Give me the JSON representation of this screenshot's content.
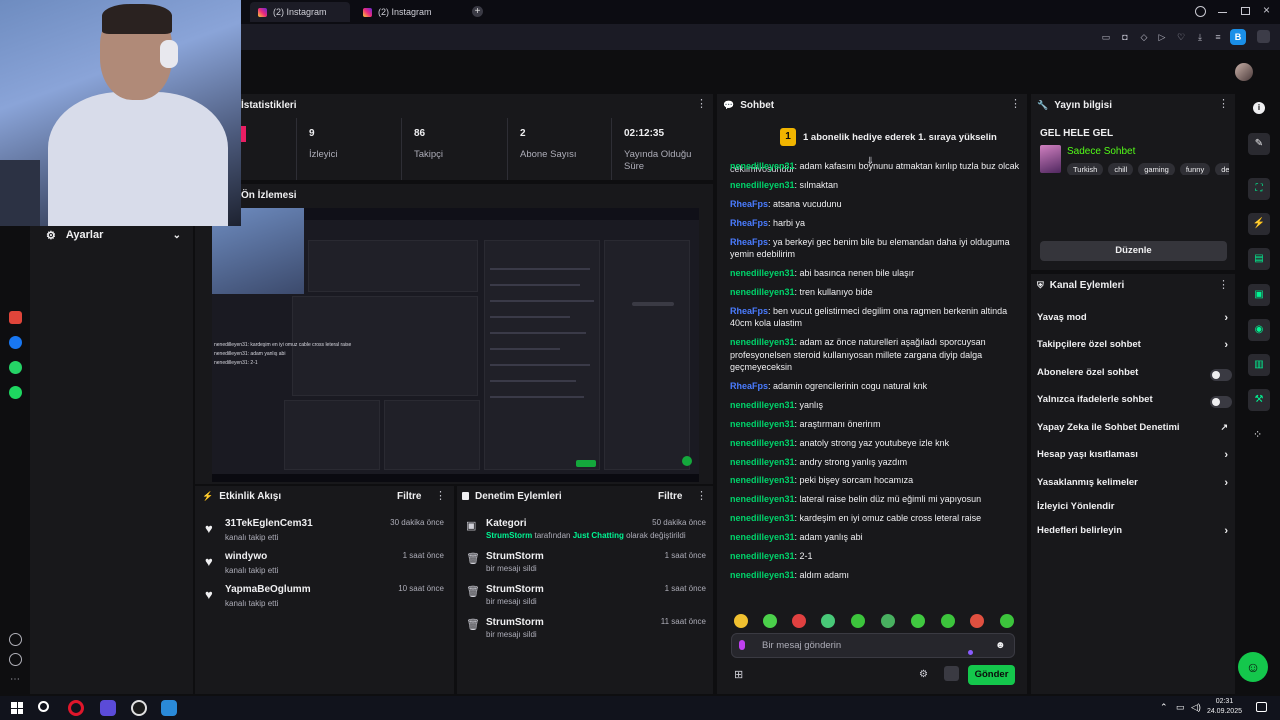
{
  "browser": {
    "tabs": [
      {
        "label": "(2) Instagram"
      },
      {
        "label": "(2) Instagram"
      }
    ],
    "avatar_letter": "B"
  },
  "left_panel": {
    "settings_label": "Ayarlar"
  },
  "stats": {
    "title": "İstatistikleri",
    "items": [
      {
        "value": "9",
        "label": "İzleyici"
      },
      {
        "value": "86",
        "label": "Takipçi"
      },
      {
        "value": "2",
        "label": "Abone Sayısı"
      },
      {
        "value": "02:12:35",
        "label": "Yayında Olduğu Süre"
      }
    ]
  },
  "preview": {
    "title": "Ön İzlemesi",
    "mini_chat": [
      "nenedilleyen31: kardeşim en iyi omuz cable cross leteral raise",
      "nenedilleyen31: adam yanlış abi",
      "nenedilleyen31: 2-1"
    ]
  },
  "activity": {
    "title": "Etkinlik Akışı",
    "filter_label": "Filtre",
    "items": [
      {
        "name": "31TekEglenCem31",
        "sub": "kanalı takip etti",
        "time": "30 dakika önce"
      },
      {
        "name": "windywo",
        "sub": "kanalı takip etti",
        "time": "1 saat önce"
      },
      {
        "name": "YapmaBeOglumm",
        "sub": "kanalı takip etti",
        "time": "10 saat önce"
      }
    ]
  },
  "mod_actions": {
    "title": "Denetim Eylemleri",
    "filter_label": "Filtre",
    "category": {
      "name": "Kategori",
      "time": "50 dakika önce",
      "actor": "StrumStorm",
      "mid": "tarafından",
      "game": "Just Chatting",
      "tail": "olarak değiştirildi"
    },
    "items": [
      {
        "name": "StrumStorm",
        "sub": "bir mesajı sildi",
        "time": "1 saat önce"
      },
      {
        "name": "StrumStorm",
        "sub": "bir mesajı sildi",
        "time": "1 saat önce"
      },
      {
        "name": "StrumStorm",
        "sub": "bir mesajı sildi",
        "time": "11 saat önce"
      }
    ]
  },
  "chat": {
    "title": "Sohbet",
    "banner_rank": "1",
    "banner": "1 abonelik hediye ederek 1. sıraya yükselin",
    "partial_top": "çekilmiyosundur",
    "messages": [
      {
        "user": "nenedilleyen31",
        "color": "green",
        "text": ": adam kafasını boynunu atmaktan kırılıp tuzla buz olcak"
      },
      {
        "user": "nenedilleyen31",
        "color": "green",
        "text": ": sılmaktan"
      },
      {
        "user": "RheaFps",
        "color": "blue",
        "text": ": atsana vucudunu"
      },
      {
        "user": "RheaFps",
        "color": "blue",
        "text": ": harbi ya"
      },
      {
        "user": "RheaFps",
        "color": "blue",
        "text": ": ya berkeyi gec benim bile bu elemandan daha iyi olduguma yemin edebilirim"
      },
      {
        "user": "nenedilleyen31",
        "color": "green",
        "text": ": abi basınca nenen bile ulaşır"
      },
      {
        "user": "nenedilleyen31",
        "color": "green",
        "text": ": tren kullanıyo bide"
      },
      {
        "user": "RheaFps",
        "color": "blue",
        "text": ": ben vucut gelistirmeci degilim ona ragmen berkenin altinda 40cm kola ulastim"
      },
      {
        "user": "nenedilleyen31",
        "color": "green",
        "text": ": adam az önce naturelleri aşağıladı sporcuysan profesyonelsen steroid kullanıyosan millete zargana diyip dalga geçmeyeceksin"
      },
      {
        "user": "RheaFps",
        "color": "blue",
        "text": ": adamin ogrencilerinin cogu natural knk"
      },
      {
        "user": "nenedilleyen31",
        "color": "green",
        "text": ": yanlış"
      },
      {
        "user": "nenedilleyen31",
        "color": "green",
        "text": ": araştırmanı önerirım"
      },
      {
        "user": "nenedilleyen31",
        "color": "green",
        "text": ": anatoly strong yaz youtubeye izle knk"
      },
      {
        "user": "nenedilleyen31",
        "color": "green",
        "text": ": andry strong yanlış yazdım"
      },
      {
        "user": "nenedilleyen31",
        "color": "green",
        "text": ": peki bişey sorcam hocamıza"
      },
      {
        "user": "nenedilleyen31",
        "color": "green",
        "text": ": lateral raise belin düz mü eğimli mi yapıyosun"
      },
      {
        "user": "nenedilleyen31",
        "color": "green",
        "text": ": kardeşim en iyi omuz cable cross leteral raise"
      },
      {
        "user": "nenedilleyen31",
        "color": "green",
        "text": ": adam yanlış abi"
      },
      {
        "user": "nenedilleyen31",
        "color": "green",
        "text": ": 2-1"
      },
      {
        "user": "nenedilleyen31",
        "color": "green",
        "text": ": aldım adamı"
      }
    ],
    "input_placeholder": "Bir mesaj gönderin",
    "send_label": "Gönder"
  },
  "stream_info": {
    "title": "Yayın bilgisi",
    "stream_title": "GEL HELE GEL",
    "category": "Sadece Sohbet",
    "tags": [
      "Turkish",
      "chill",
      "gaming",
      "funny",
      "de"
    ],
    "edit_label": "Düzenle"
  },
  "channel_actions": {
    "title": "Kanal Eylemleri",
    "rows": [
      {
        "label": "Yavaş mod",
        "control": "chevron"
      },
      {
        "label": "Takipçilere özel sohbet",
        "control": "chevron"
      },
      {
        "label": "Abonelere özel sohbet",
        "control": "toggle"
      },
      {
        "label": "Yalnızca ifadelerle sohbet",
        "control": "toggle"
      },
      {
        "label": "Yapay Zeka ile Sohbet Denetimi",
        "control": "external"
      },
      {
        "label": "Hesap yaşı kısıtlaması",
        "control": "chevron"
      },
      {
        "label": "Yasaklanmış kelimeler",
        "control": "chevron"
      },
      {
        "label": "İzleyici Yönlendir",
        "control": "none"
      },
      {
        "label": "Hedefleri belirleyin",
        "control": "chevron"
      }
    ]
  },
  "taskbar": {
    "time": "02:31",
    "date": "24.09.2025"
  },
  "colors": {
    "accent_green": "#14c74c",
    "username_green": "#00d26a",
    "username_blue": "#4a7cff",
    "panel_bg": "#18181b",
    "page_bg": "#0e0e10"
  }
}
